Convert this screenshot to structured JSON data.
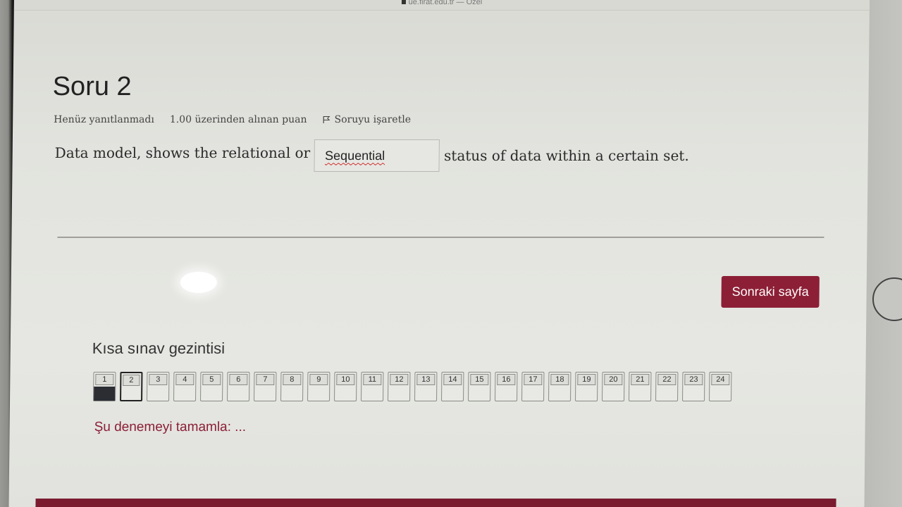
{
  "browser": {
    "url_fragment": "ue.firat.edu.tr — Özel"
  },
  "question": {
    "title": "Soru 2",
    "status": "Henüz yanıtlanmadı",
    "points": "1.00 üzerinden alınan puan",
    "flag_label": "Soruyu işaretle",
    "text_before": "Data model, shows the relational or",
    "answer_value": "Sequential",
    "text_after": "status of data within a certain set."
  },
  "next_button": {
    "label": "Sonraki sayfa"
  },
  "quiz_nav": {
    "title": "Kısa sınav gezintisi",
    "items": [
      {
        "label": "1",
        "state": "answered"
      },
      {
        "label": "2",
        "state": "current"
      },
      {
        "label": "3",
        "state": "unanswered"
      },
      {
        "label": "4",
        "state": "unanswered"
      },
      {
        "label": "5",
        "state": "unanswered"
      },
      {
        "label": "6",
        "state": "unanswered"
      },
      {
        "label": "7",
        "state": "unanswered"
      },
      {
        "label": "8",
        "state": "unanswered"
      },
      {
        "label": "9",
        "state": "unanswered"
      },
      {
        "label": "10",
        "state": "unanswered"
      },
      {
        "label": "11",
        "state": "unanswered"
      },
      {
        "label": "12",
        "state": "unanswered"
      },
      {
        "label": "13",
        "state": "unanswered"
      },
      {
        "label": "14",
        "state": "unanswered"
      },
      {
        "label": "15",
        "state": "unanswered"
      },
      {
        "label": "16",
        "state": "unanswered"
      },
      {
        "label": "17",
        "state": "unanswered"
      },
      {
        "label": "18",
        "state": "unanswered"
      },
      {
        "label": "19",
        "state": "unanswered"
      },
      {
        "label": "20",
        "state": "unanswered"
      },
      {
        "label": "21",
        "state": "unanswered"
      },
      {
        "label": "22",
        "state": "unanswered"
      },
      {
        "label": "23",
        "state": "unanswered"
      },
      {
        "label": "24",
        "state": "unanswered"
      }
    ],
    "finish_link": "Şu denemeyi tamamla: ..."
  },
  "colors": {
    "accent": "#8c1f36",
    "answered_fill": "#2b2d33"
  },
  "icons": {
    "flag": "flag-icon"
  }
}
